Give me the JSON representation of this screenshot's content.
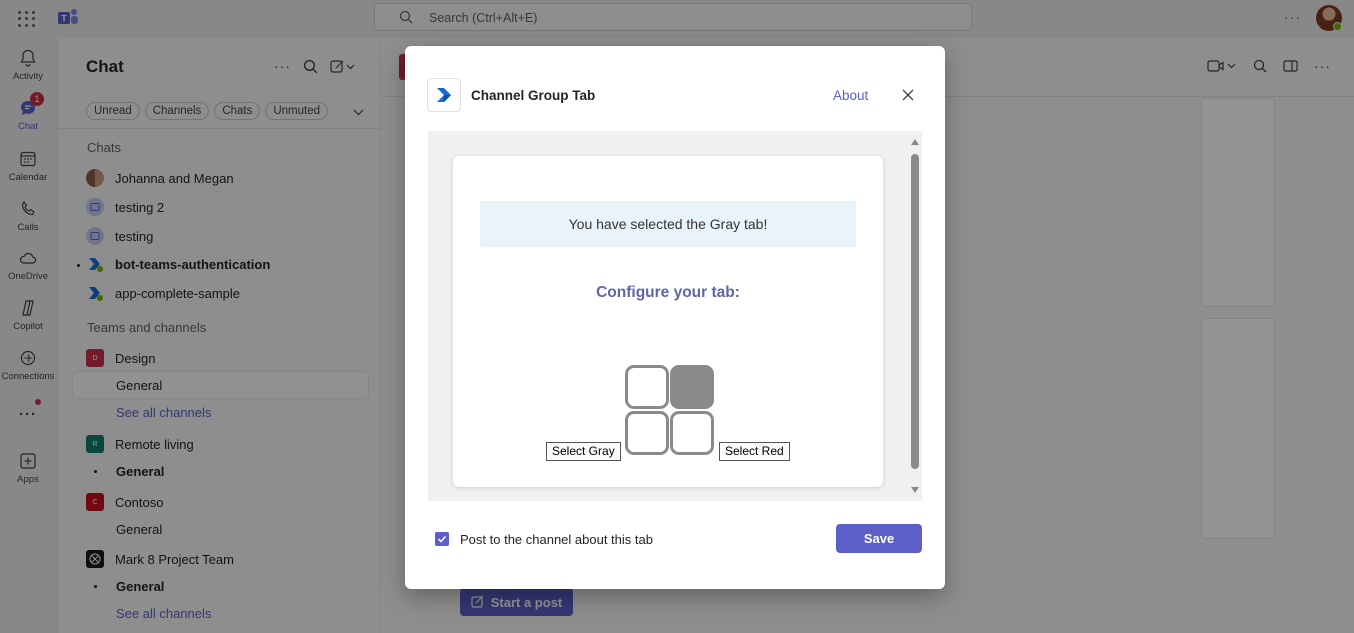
{
  "topbar": {
    "search_placeholder": "Search (Ctrl+Alt+E)",
    "more": "···"
  },
  "rail": {
    "items": [
      {
        "label": "Activity",
        "icon": "bell-icon"
      },
      {
        "label": "Chat",
        "icon": "chat-icon",
        "badge": "1",
        "active": true
      },
      {
        "label": "Calendar",
        "icon": "calendar-icon"
      },
      {
        "label": "Calls",
        "icon": "phone-icon"
      },
      {
        "label": "OneDrive",
        "icon": "cloud-icon"
      },
      {
        "label": "Copilot",
        "icon": "copilot-icon"
      },
      {
        "label": "Connections",
        "icon": "connections-icon"
      },
      {
        "label": "···",
        "icon": "more-icon"
      },
      {
        "label": "Apps",
        "icon": "apps-icon"
      }
    ]
  },
  "chat_panel": {
    "title": "Chat",
    "filters": [
      "Unread",
      "Channels",
      "Chats",
      "Unmuted"
    ],
    "chats_heading": "Chats",
    "chats": [
      {
        "name": "Johanna and Megan"
      },
      {
        "name": "testing 2"
      },
      {
        "name": "testing"
      },
      {
        "name": "bot-teams-authentication"
      },
      {
        "name": "app-complete-sample"
      }
    ],
    "teams_heading": "Teams and channels",
    "teams": [
      {
        "name": "Design",
        "initial": "D",
        "color": "#c4314b",
        "channel": "General",
        "see_all": "See all channels"
      },
      {
        "name": "Remote living",
        "initial": "R",
        "color": "#0f7b6c",
        "channel": "General"
      },
      {
        "name": "Contoso",
        "initial": "C",
        "color": "#c50f1f",
        "channel": "General"
      },
      {
        "name": "Mark 8 Project Team",
        "channel": "General",
        "see_all": "See all channels"
      }
    ]
  },
  "main": {
    "start_post": "Start a post"
  },
  "dialog": {
    "title": "Channel Group Tab",
    "about": "About",
    "alert": "You have selected the Gray tab!",
    "configure": "Configure your tab:",
    "select_gray": "Select Gray",
    "select_red": "Select Red",
    "checkbox_label": "Post to the channel about this tab",
    "checkbox_checked": true,
    "save": "Save"
  },
  "colors": {
    "accent": "#5b5fc7",
    "configure_text": "#6264a7",
    "gray_tile": "#8a8a8a"
  }
}
